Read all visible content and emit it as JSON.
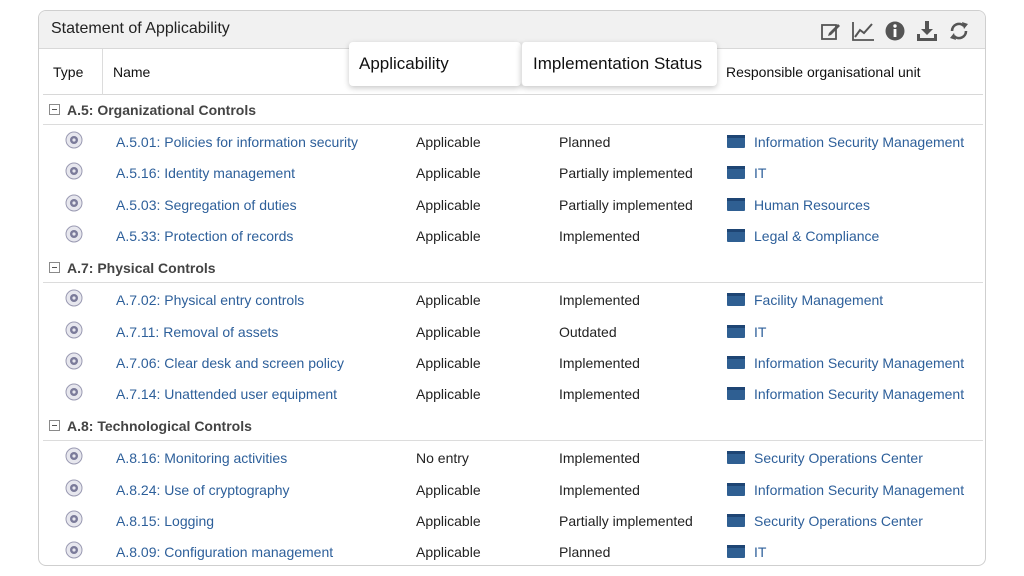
{
  "panel": {
    "title": "Statement of Applicability"
  },
  "toolbar": {
    "icons": [
      "edit-icon",
      "chart-icon",
      "info-icon",
      "download-icon",
      "refresh-icon"
    ]
  },
  "columns": {
    "type": "Type",
    "name": "Name",
    "applicability": "Applicability",
    "implementation": "Implementation Status",
    "responsible": "Responsible organisational unit"
  },
  "groups": [
    {
      "label": "A.5: Organizational Controls",
      "rows": [
        {
          "name": "A.5.01: Policies for information security",
          "applicability": "Applicable",
          "status": "Planned",
          "unit": "Information Security Management"
        },
        {
          "name": "A.5.16: Identity management",
          "applicability": "Applicable",
          "status": "Partially implemented",
          "unit": "IT"
        },
        {
          "name": "A.5.03: Segregation of duties",
          "applicability": "Applicable",
          "status": "Partially implemented",
          "unit": "Human Resources"
        },
        {
          "name": "A.5.33: Protection of records",
          "applicability": "Applicable",
          "status": "Implemented",
          "unit": "Legal & Compliance"
        }
      ]
    },
    {
      "label": "A.7: Physical Controls",
      "rows": [
        {
          "name": "A.7.02: Physical entry controls",
          "applicability": "Applicable",
          "status": "Implemented",
          "unit": "Facility Management"
        },
        {
          "name": "A.7.11: Removal of assets",
          "applicability": "Applicable",
          "status": "Outdated",
          "unit": "IT"
        },
        {
          "name": "A.7.06: Clear desk and screen policy",
          "applicability": "Applicable",
          "status": "Implemented",
          "unit": "Information Security Management"
        },
        {
          "name": "A.7.14: Unattended user equipment",
          "applicability": "Applicable",
          "status": "Implemented",
          "unit": "Information Security Management"
        }
      ]
    },
    {
      "label": "A.8: Technological Controls",
      "rows": [
        {
          "name": "A.8.16: Monitoring activities",
          "applicability": "No entry",
          "status": "Implemented",
          "unit": "Security Operations Center"
        },
        {
          "name": "A.8.24: Use of cryptography",
          "applicability": "Applicable",
          "status": "Implemented",
          "unit": "Information Security Management"
        },
        {
          "name": "A.8.15: Logging",
          "applicability": "Applicable",
          "status": "Partially implemented",
          "unit": "Security Operations Center"
        },
        {
          "name": "A.8.09: Configuration management",
          "applicability": "Applicable",
          "status": "Planned",
          "unit": "IT"
        }
      ]
    }
  ],
  "colors": {
    "link": "#2d5f9a",
    "unit_icon": "#2f5f92",
    "eye": "#7b7b9a"
  }
}
